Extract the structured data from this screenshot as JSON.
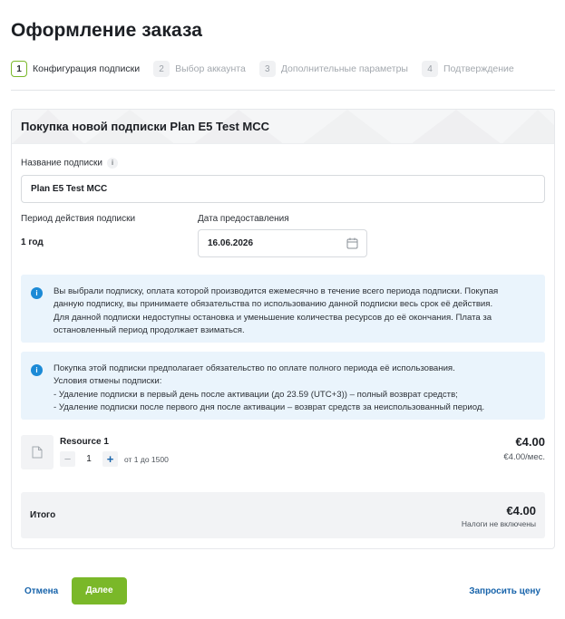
{
  "page": {
    "title": "Оформление заказа"
  },
  "steps": [
    {
      "num": "1",
      "label": "Конфигурация подписки",
      "active": true
    },
    {
      "num": "2",
      "label": "Выбор аккаунта",
      "active": false
    },
    {
      "num": "3",
      "label": "Дополнительные параметры",
      "active": false
    },
    {
      "num": "4",
      "label": "Подтверждение",
      "active": false
    }
  ],
  "card": {
    "title": "Покупка новой подписки Plan E5 Test MCC",
    "name_label": "Название подписки",
    "name_value": "Plan E5 Test MCC",
    "period_label": "Период действия подписки",
    "period_value": "1 год",
    "date_label": "Дата предоставления",
    "date_value": "16.06.2026"
  },
  "notes": [
    {
      "lines": [
        "Вы выбрали подписку, оплата которой производится ежемесячно в течение всего периода подписки. Покупая",
        "данную подписку, вы принимаете обязательства по использованию данной подписки весь срок её действия.",
        "Для данной подписки недоступны остановка и уменьшение количества ресурсов до её окончания. Плата за",
        "остановленный период продолжает взиматься."
      ]
    },
    {
      "lines": [
        "Покупка этой подписки предполагает обязательство по оплате полного периода её использования.",
        "Условия отмены подписки:",
        "- Удаление подписки в первый день после активации (до 23.59 (UTC+3)) – полный возврат средств;",
        "- Удаление подписки после первого дня после активации – возврат средств за неиспользованный период."
      ]
    }
  ],
  "resource": {
    "name": "Resource 1",
    "quantity": "1",
    "range": "от 1 до 1500",
    "price": "€4.00",
    "per_month": "€4.00/мес."
  },
  "total": {
    "label": "Итого",
    "price": "€4.00",
    "tax_note": "Налоги не включены"
  },
  "footer": {
    "cancel": "Отмена",
    "next": "Далее",
    "quote": "Запросить цену"
  },
  "colors": {
    "accent_green": "#7ab829",
    "link_blue": "#1864ab",
    "info_bg": "#eaf4fc",
    "info_icon": "#1c8ad6"
  },
  "icons": {
    "date": "calendar-icon",
    "info": "info-icon",
    "resource": "document-icon"
  }
}
